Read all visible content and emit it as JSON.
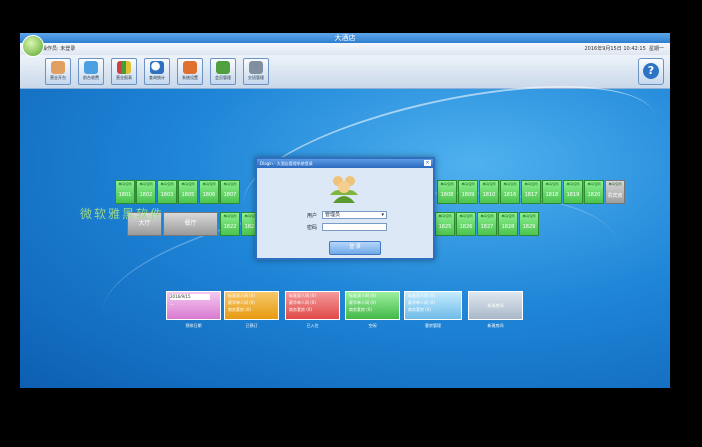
{
  "window": {
    "title": "大酒店"
  },
  "infobar": {
    "operator": "操作员: 未登录",
    "datetime": "2016年9月15日 10:42:15",
    "weekday": "星期一"
  },
  "toolbar": {
    "buttons": [
      {
        "label": "营业开台",
        "icon": "waiter-icon",
        "color": "#e0a060"
      },
      {
        "label": "前台收费",
        "icon": "cashier-icon",
        "color": "#4aa0e0"
      },
      {
        "label": "营业报表",
        "icon": "chart-icon",
        "color": "#d04040"
      },
      {
        "label": "查询统计",
        "icon": "magnifier-icon",
        "color": "#3070c0"
      },
      {
        "label": "系统设置",
        "icon": "house-icon",
        "color": "#e07030"
      },
      {
        "label": "会员管理",
        "icon": "members-icon",
        "color": "#50a040"
      },
      {
        "label": "交班管理",
        "icon": "tools-icon",
        "color": "#8090a0"
      }
    ],
    "help": "?"
  },
  "rooms_row1": [
    "1801",
    "1802",
    "1803",
    "1805",
    "1806",
    "1807",
    "1808",
    "1809",
    "1810",
    "1816",
    "1817",
    "1818",
    "1819",
    "1820",
    "贵宾房"
  ],
  "rooms_row2": [
    "1822",
    "1823",
    "1825",
    "1826",
    "1827",
    "1828",
    "1829"
  ],
  "room_tag": "单间/空闲",
  "halls": [
    "大厅",
    "餐厅"
  ],
  "watermark": "微软雅黑软件",
  "panels": [
    {
      "cap": "预排日期",
      "lines": [
        "2016/9/15",
        "—"
      ],
      "color": "#e08ad8"
    },
    {
      "cap": "已预订",
      "lines": [
        "标准双人间 (0)",
        "豪华单人间 (0)",
        "商务套房 (0)"
      ],
      "color": "#f0a020"
    },
    {
      "cap": "已入住",
      "lines": [
        "标准双人间 (0)",
        "豪华单人间 (0)",
        "商务套房 (0)"
      ],
      "color": "#e85050"
    },
    {
      "cap": "空闲",
      "lines": [
        "标准双人间 (0)",
        "豪华单人间 (0)",
        "商务套房 (0)"
      ],
      "color": "#4cc34f"
    },
    {
      "cap": "客房管理",
      "lines": [
        "标准双人间 (0)",
        "豪华单人间 (0)",
        "商务套房 (0)"
      ],
      "color": "#7fc9f0"
    },
    {
      "cap": "新建房间",
      "lines": [
        "新建房间"
      ],
      "color": "#b9c7d6"
    }
  ],
  "login": {
    "title": "Dlogin - 大酒店管理系统登录",
    "user_label": "用户",
    "user_value": "管理员",
    "pwd_label": "密码",
    "button": "登 录"
  }
}
